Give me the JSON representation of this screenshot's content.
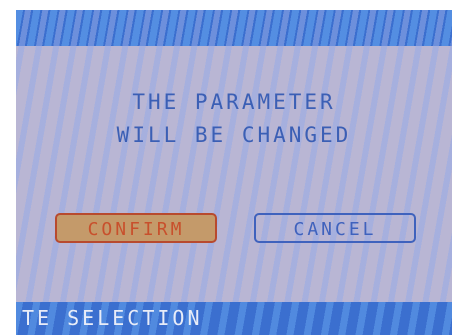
{
  "dialog": {
    "message_line1": "THE PARAMETER",
    "message_line2": "WILL BE CHANGED",
    "confirm_label": "CONFIRM",
    "cancel_label": "CANCEL"
  },
  "status_bar": {
    "text": "TE SELECTION"
  },
  "colors": {
    "background": "#b9b6d4",
    "bar": "#3b6fcf",
    "text": "#3b5fb5",
    "confirm_fill": "#c49a6a",
    "confirm_text": "#c8502c",
    "cancel_border": "#3f62bd"
  }
}
